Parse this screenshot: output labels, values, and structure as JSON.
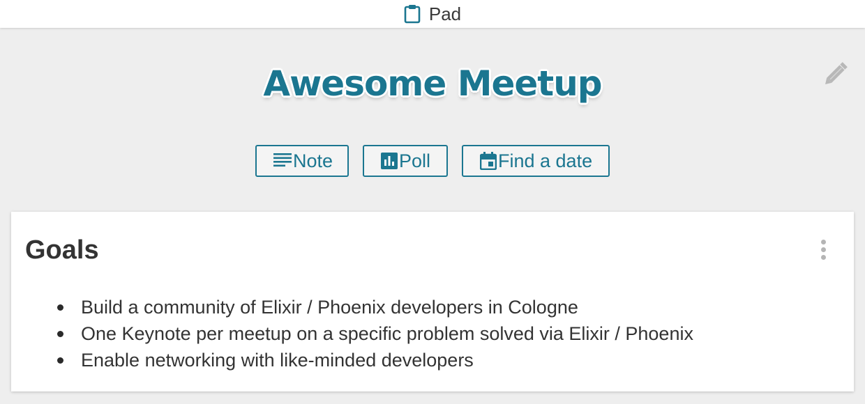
{
  "header": {
    "app_name": "Pad",
    "app_icon": "clipboard-icon"
  },
  "pad": {
    "title": "Awesome Meetup",
    "edit_icon": "pencil-icon"
  },
  "actions": [
    {
      "label": "Note",
      "icon": "note-icon"
    },
    {
      "label": "Poll",
      "icon": "poll-icon"
    },
    {
      "label": "Find a date",
      "icon": "calendar-icon"
    }
  ],
  "card": {
    "title": "Goals",
    "menu_icon": "more-vertical-icon",
    "items": [
      "Build a community of Elixir / Phoenix developers in Cologne",
      "One Keynote per meetup on a specific problem solved via Elixir / Phoenix",
      "Enable networking with like-minded developers"
    ]
  },
  "colors": {
    "accent": "#1b7690",
    "background": "#eeeeee",
    "card": "#ffffff",
    "text": "#333333"
  }
}
